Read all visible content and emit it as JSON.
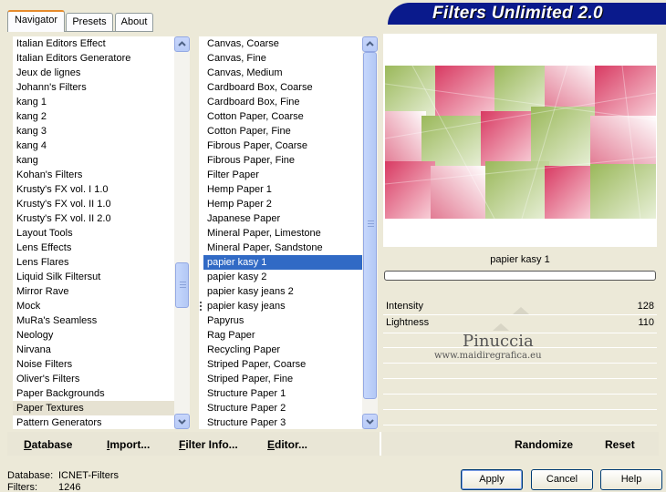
{
  "tabs": [
    "Navigator",
    "Presets",
    "About"
  ],
  "banner_title": "Filters Unlimited 2.0",
  "categories": [
    "Italian Editors Effect",
    "Italian Editors Generatore",
    "Jeux de lignes",
    "Johann's Filters",
    "kang 1",
    "kang 2",
    "kang 3",
    "kang 4",
    "kang",
    "Kohan's Filters",
    "Krusty's FX vol. I 1.0",
    "Krusty's FX vol. II 1.0",
    "Krusty's FX vol. II 2.0",
    "Layout Tools",
    "Lens Effects",
    "Lens Flares",
    "Liquid Silk Filtersut",
    "Mirror Rave",
    "Mock",
    "MuRa's Seamless",
    "Neology",
    "Nirvana",
    "Noise Filters",
    "Oliver's Filters",
    "Paper Backgrounds",
    "Paper Textures",
    "Pattern Generators"
  ],
  "selected_category": "Paper Textures",
  "filters": [
    "Canvas, Coarse",
    "Canvas, Fine",
    "Canvas, Medium",
    "Cardboard Box, Coarse",
    "Cardboard Box, Fine",
    "Cotton Paper, Coarse",
    "Cotton Paper, Fine",
    "Fibrous Paper, Coarse",
    "Fibrous Paper, Fine",
    "Filter Paper",
    "Hemp Paper 1",
    "Hemp Paper 2",
    "Japanese Paper",
    "Mineral Paper, Limestone",
    "Mineral Paper, Sandstone",
    "papier kasy 1",
    "papier kasy 2",
    "papier kasy jeans 2",
    "papier kasy jeans",
    "Papyrus",
    "Rag Paper",
    "Recycling Paper",
    "Striped Paper, Coarse",
    "Striped Paper, Fine",
    "Structure Paper 1",
    "Structure Paper 2",
    "Structure Paper 3"
  ],
  "selected_filter": "papier kasy 1",
  "preview": {
    "filter_name": "papier kasy 1"
  },
  "sliders": [
    {
      "label": "Intensity",
      "value": "128"
    },
    {
      "label": "Lightness",
      "value": "110"
    }
  ],
  "watermark": {
    "line1": "Pinuccia",
    "line2": "www.maidiregrafica.eu"
  },
  "bottom_buttons": {
    "database": "Database",
    "import": "Import...",
    "filter_info": "Filter Info...",
    "editor": "Editor...",
    "randomize": "Randomize",
    "reset": "Reset"
  },
  "dialog_buttons": {
    "apply": "Apply",
    "cancel": "Cancel",
    "help": "Help"
  },
  "status": {
    "database_label": "Database:",
    "database_value": "ICNET-Filters",
    "filters_label": "Filters:",
    "filters_value": "1246"
  },
  "colors": {
    "banner": "#0a1a8c",
    "selection": "#316ac5",
    "tab_highlight": "#e68b2c"
  }
}
